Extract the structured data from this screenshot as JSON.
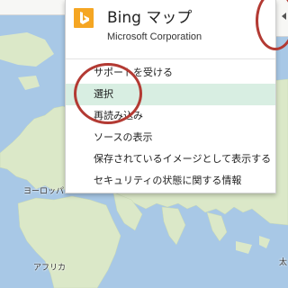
{
  "app": {
    "title": "Bing マップ",
    "publisher": "Microsoft Corporation",
    "logo_color": "#f5a623"
  },
  "menu": {
    "items": [
      {
        "label": "サポートを受ける",
        "selected": false
      },
      {
        "label": "選択",
        "selected": true
      },
      {
        "label": "再読み込み",
        "selected": false
      },
      {
        "label": "ソースの表示",
        "selected": false
      },
      {
        "label": "保存されているイメージとして表示する",
        "selected": false
      },
      {
        "label": "セキュリティの状態に関する情報",
        "selected": false
      }
    ],
    "selected_color": "#d8eee2"
  },
  "map": {
    "labels": {
      "europe": "ヨーロッパ",
      "africa": "アフリカ",
      "edge": "太"
    },
    "ocean_color": "#a8c8e6",
    "land_color": "#dbe8c8"
  },
  "annotation_color": "#b33a33"
}
